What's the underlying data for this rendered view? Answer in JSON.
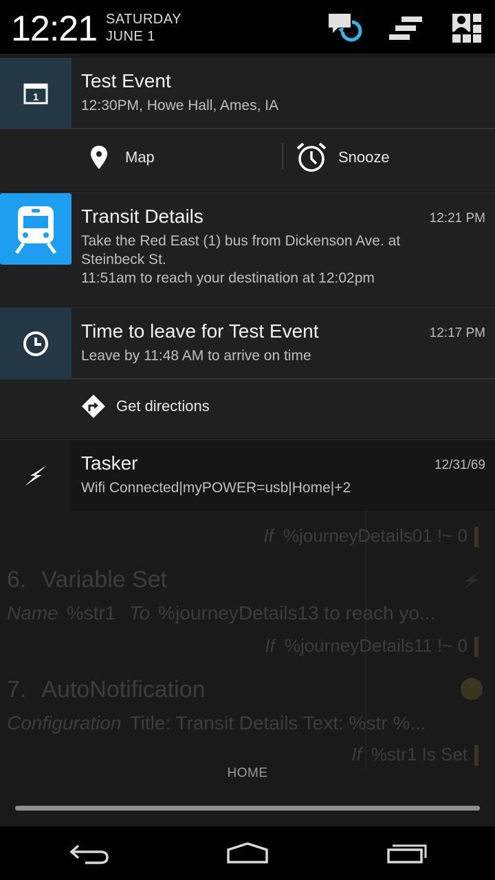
{
  "status": {
    "time": "12:21",
    "day": "SATURDAY",
    "date": "JUNE 1",
    "icons": [
      "chat-sync-icon",
      "clear-all-icon",
      "quick-settings-icon"
    ]
  },
  "notifications": [
    {
      "app_icon": "calendar-icon",
      "icon_text": "1",
      "title": "Test Event",
      "text": "12:30PM, Howe Hall, Ames, IA",
      "actions": [
        {
          "icon": "map-pin-icon",
          "label": "Map"
        },
        {
          "icon": "alarm-clock-icon",
          "label": "Snooze"
        }
      ]
    },
    {
      "app_icon": "train-icon",
      "title": "Transit Details",
      "time": "12:21 PM",
      "text_line1": "Take the Red East (1) bus from Dickenson Ave. at",
      "text_line2": "Steinbeck St.",
      "text_line3": "11:51am to reach your destination at 12:02pm"
    },
    {
      "app_icon": "clock-icon",
      "title": "Time to leave for Test Event",
      "time": "12:17 PM",
      "text": "Leave by 11:48 AM to arrive on time",
      "actions": [
        {
          "icon": "directions-icon",
          "label": "Get directions"
        }
      ]
    },
    {
      "app_icon": "lightning-icon",
      "title": "Tasker",
      "time": "12/31/69",
      "text": "Wifi Connected|myPOWER=usb|Home|+2"
    }
  ],
  "background": {
    "condition_label": "If",
    "condition_1": "%journeyDetails01 !~ 0",
    "step6_num": "6.",
    "step6_title": "Variable Set",
    "step6_name_label": "Name",
    "step6_name": "%str1",
    "step6_to_label": "To",
    "step6_to": "%journeyDetails13 to reach yo...",
    "condition_2": "%journeyDetails11 !~ 0",
    "step7_num": "7.",
    "step7_title": "AutoNotification",
    "step7_config_label": "Configuration",
    "step7_config": "Title: Transit Details Text: %str %...",
    "condition_3": "%str1 Is Set",
    "home_label": "HOME"
  },
  "navbar": [
    "back-icon",
    "home-icon",
    "recents-icon"
  ],
  "colors": {
    "calendar_icon_bg": "#233744",
    "transit_icon_bg": "#1e9ef0",
    "tasker_icon_bg": "#161616",
    "notif_bg": "#202020",
    "divider": "#2c2c2c",
    "accent": "#33b5e5"
  }
}
